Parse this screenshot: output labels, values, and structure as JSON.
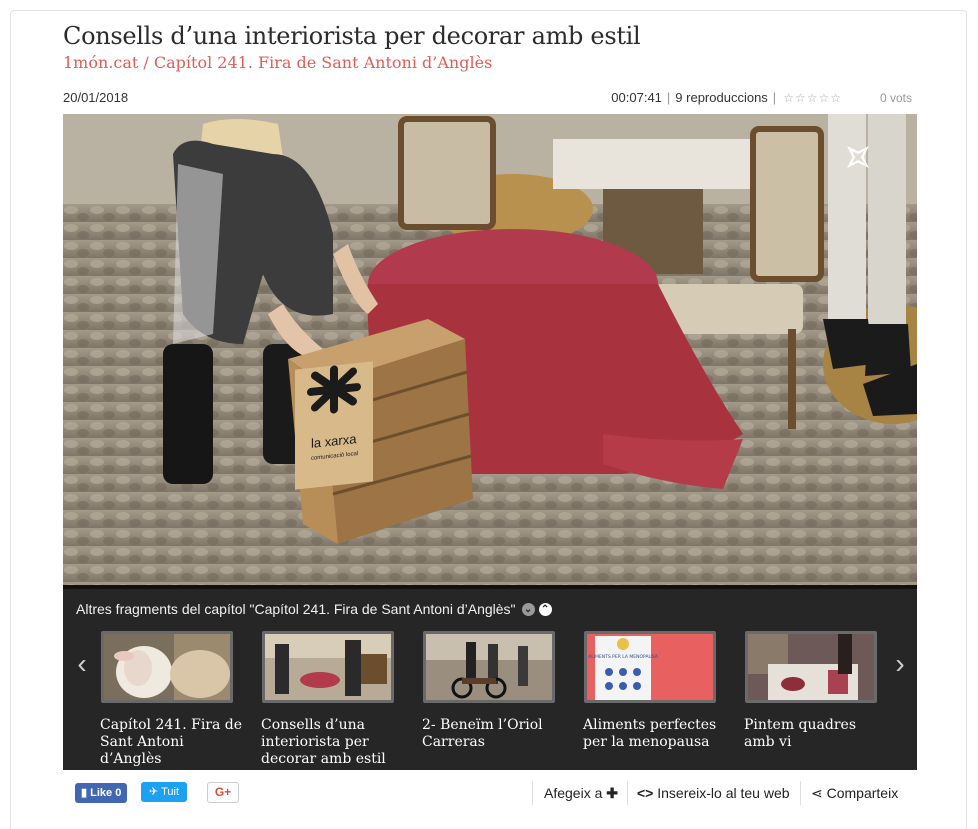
{
  "header": {
    "title": "Consells d’una interiorista per decorar amb estil",
    "channel": "1món.cat",
    "separator": "/",
    "chapter": "Capítol 241. Fira de Sant Antoni d’Anglès"
  },
  "meta": {
    "date": "20/01/2018",
    "duration": "00:07:41",
    "plays": "9 reproduccions",
    "rating_stars": "☆☆☆☆☆",
    "votes": "0 vots"
  },
  "video": {
    "logo_line1": "la xarxa",
    "logo_line2": "comunicació local"
  },
  "fragments": {
    "heading": "Altres fragments del capítol \"Capítol 241. Fira de Sant Antoni d’Anglès\"",
    "collapse_icon": "chevron-down-icon",
    "expand_icon": "chevron-up-icon",
    "items": [
      {
        "label": "Capítol 241. Fira de Sant Antoni d’Anglès"
      },
      {
        "label": "Consells d’una interiorista per decorar amb estil"
      },
      {
        "label": "2- Beneïm l’Oriol Carreras"
      },
      {
        "label": "Aliments perfectes per la menopausa"
      },
      {
        "label": "Pintem quadres amb vi"
      }
    ],
    "thumb_poster_text": "ALIMENTS PER LA MENOPAUSA"
  },
  "actions": {
    "like": "Like 0",
    "tweet": "Tuit",
    "gplus": "G+",
    "add": "Afegeix a",
    "embed": "Insereix-lo al teu web",
    "share": "Comparteix"
  },
  "colors": {
    "accent": "#e05d55",
    "strip_bg": "#262626",
    "facebook": "#4267b2",
    "twitter": "#1da1f2"
  }
}
